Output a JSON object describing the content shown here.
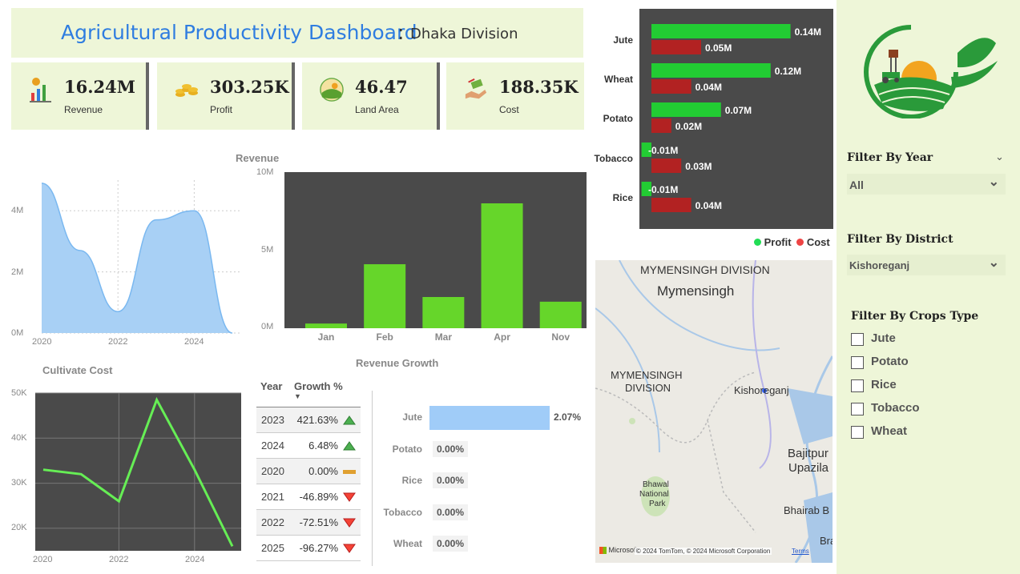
{
  "title": {
    "main": "Agricultural Productivity Dashboard",
    "colon": ":",
    "sub": "Dhaka Division"
  },
  "kpis": [
    {
      "value": "16.24M",
      "label": "Revenue",
      "icon": "revenue-chart-icon"
    },
    {
      "value": "303.25K",
      "label": "Profit",
      "icon": "coins-icon"
    },
    {
      "value": "46.47",
      "label": "Land Area",
      "icon": "land-field-icon"
    },
    {
      "value": "188.35K",
      "label": "Cost",
      "icon": "cost-hand-icon"
    }
  ],
  "area_chart": {
    "y_ticks": [
      "4M",
      "2M",
      "0M"
    ],
    "x_ticks": [
      "2020",
      "2022",
      "2024"
    ]
  },
  "revenue_chart": {
    "title": "Revenue",
    "y_ticks": [
      "10M",
      "5M",
      "0M"
    ]
  },
  "cultivate_chart": {
    "title": "Cultivate  Cost",
    "y_ticks": [
      "50K",
      "40K",
      "30K",
      "20K"
    ],
    "x_ticks": [
      "2020",
      "2022",
      "2024"
    ]
  },
  "growth_table": {
    "headers": {
      "year": "Year",
      "growth": "Growth %"
    },
    "rows": [
      {
        "year": "2023",
        "pct": "421.63%",
        "trend": "up"
      },
      {
        "year": "2024",
        "pct": "6.48%",
        "trend": "up"
      },
      {
        "year": "2020",
        "pct": "0.00%",
        "trend": "flat"
      },
      {
        "year": "2021",
        "pct": "-46.89%",
        "trend": "down"
      },
      {
        "year": "2022",
        "pct": "-72.51%",
        "trend": "down"
      },
      {
        "year": "2025",
        "pct": "-96.27%",
        "trend": "down"
      }
    ]
  },
  "revenue_growth": {
    "title": "Revenue Growth",
    "rows": [
      {
        "crop": "Jute",
        "value": "2.07%",
        "fraction": 1.0
      },
      {
        "crop": "Potato",
        "value": "0.00%",
        "fraction": 0
      },
      {
        "crop": "Rice",
        "value": "0.00%",
        "fraction": 0
      },
      {
        "crop": "Tobacco",
        "value": "0.00%",
        "fraction": 0
      },
      {
        "crop": "Wheat",
        "value": "0.00%",
        "fraction": 0
      }
    ]
  },
  "map": {
    "labels": {
      "division_top": "MYMENSINGH DIVISION",
      "city": "Mymensingh",
      "division_mid_1": "MYMENSINGH",
      "division_mid_2": "DIVISION",
      "district": "Kishoreganj",
      "bajitpur_1": "Bajitpur",
      "bajitpur_2": "Upazila",
      "park_1": "Bhawal",
      "park_2": "National",
      "park_3": "Park",
      "bhairab": "Bhairab B",
      "bra": "Bra"
    },
    "attribution": "© 2024 TomTom, © 2024 Microsoft Corporation",
    "terms": "Terms",
    "brand": "Microsoft"
  },
  "profit_cost": {
    "legend": {
      "profit": "Profit",
      "cost": "Cost"
    },
    "colors": {
      "profit": "#22cc33",
      "cost": "#b22222"
    }
  },
  "filters": {
    "year": {
      "label": "Filter By Year",
      "value": "All"
    },
    "district": {
      "label": "Filter By District",
      "value": "Kishoreganj"
    },
    "crops": {
      "label": "Filter By Crops Type",
      "options": [
        "Jute",
        "Potato",
        "Rice",
        "Tobacco",
        "Wheat"
      ]
    }
  },
  "chart_data": [
    {
      "type": "area",
      "x": [
        2020,
        2021,
        2022,
        2023,
        2024,
        2025
      ],
      "values": [
        4900000,
        2700000,
        700000,
        3700000,
        4000000,
        0
      ],
      "ylim": [
        0,
        5000000
      ]
    },
    {
      "type": "bar",
      "title": "Revenue",
      "categories": [
        "Jan",
        "Feb",
        "Mar",
        "Apr",
        "Nov"
      ],
      "values": [
        300000,
        4100000,
        2000000,
        8000000,
        1700000
      ],
      "ylim": [
        0,
        10000000
      ],
      "color": "#66d62a"
    },
    {
      "type": "line",
      "title": "Cultivate  Cost",
      "x": [
        2020,
        2021,
        2022,
        2023,
        2024,
        2025
      ],
      "values": [
        33000,
        32000,
        26000,
        48500,
        33000,
        16000
      ],
      "ylim": [
        15000,
        50000
      ],
      "color": "#66ee55"
    },
    {
      "type": "bar",
      "orientation": "horizontal",
      "categories": [
        "Jute",
        "Wheat",
        "Potato",
        "Tobacco",
        "Rice"
      ],
      "series": [
        {
          "name": "Profit",
          "values": [
            140000,
            120000,
            70000,
            -10000,
            -10000
          ],
          "labels": [
            "0.14M",
            "0.12M",
            "0.07M",
            "-0.01M",
            "-0.01M"
          ]
        },
        {
          "name": "Cost",
          "values": [
            50000,
            40000,
            20000,
            30000,
            40000
          ],
          "labels": [
            "0.05M",
            "0.04M",
            "0.02M",
            "0.03M",
            "0.04M"
          ]
        }
      ]
    }
  ]
}
